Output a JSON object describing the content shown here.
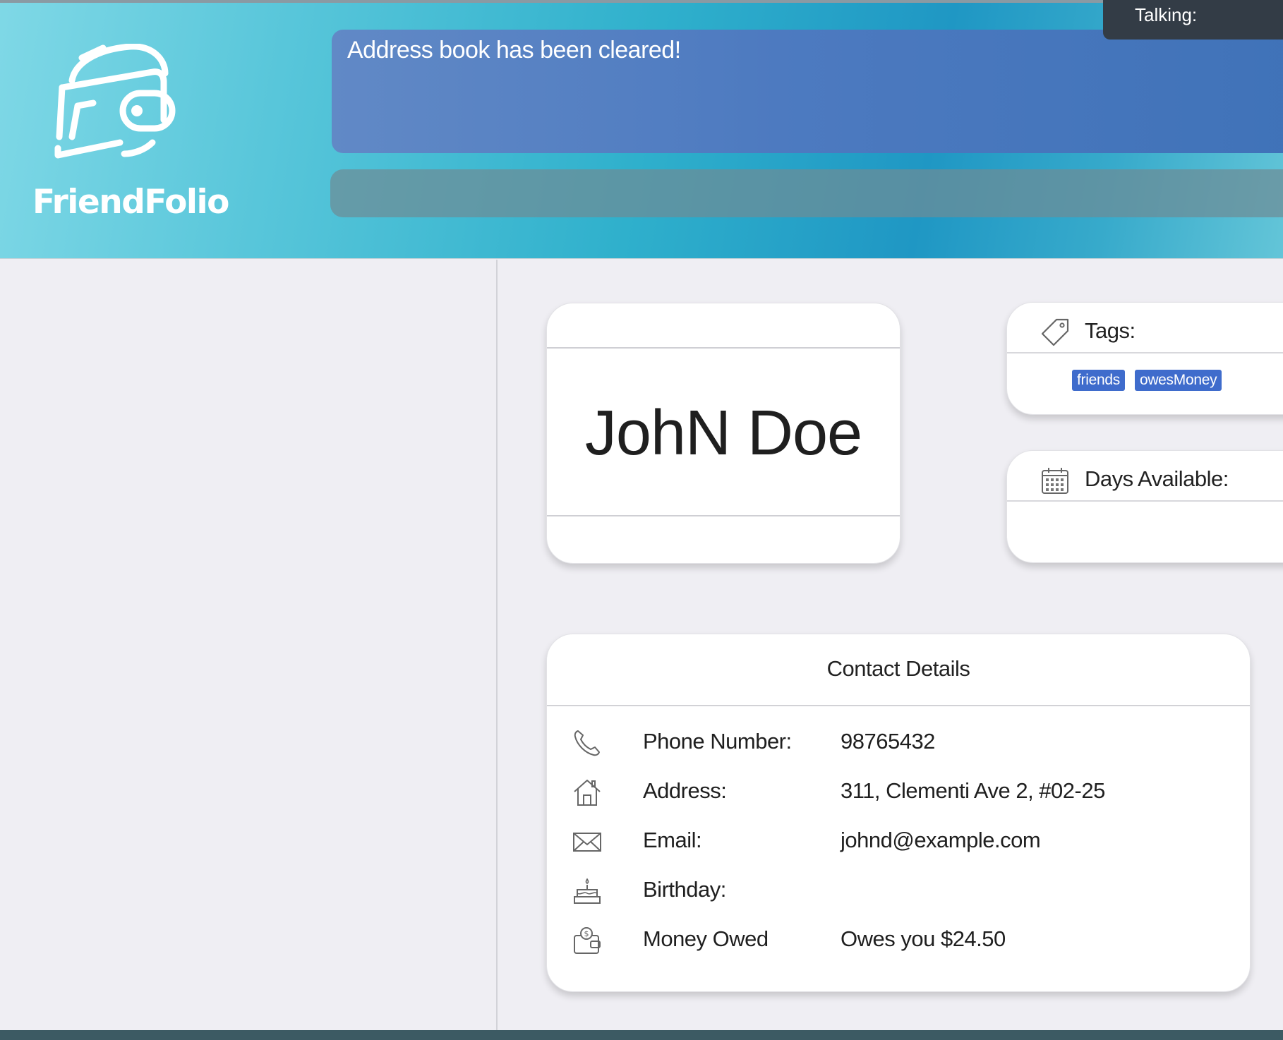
{
  "app": {
    "name": "FriendFolio",
    "talking_label": "Talking:"
  },
  "result_display": {
    "message": "Address book has been cleared!"
  },
  "command_box": {
    "value": ""
  },
  "person": {
    "name": "JohN Doe",
    "tags_title": "Tags:",
    "tags": [
      "friends",
      "owesMoney"
    ],
    "days_title": "Days Available:",
    "days": []
  },
  "contact_details": {
    "title": "Contact Details",
    "rows": [
      {
        "icon": "phone-icon",
        "label": "Phone Number:",
        "value": "98765432"
      },
      {
        "icon": "home-icon",
        "label": "Address:",
        "value": "311, Clementi Ave 2, #02-25"
      },
      {
        "icon": "mail-icon",
        "label": "Email:",
        "value": "johnd@example.com"
      },
      {
        "icon": "cake-icon",
        "label": "Birthday:",
        "value": ""
      },
      {
        "icon": "wallet-money-icon",
        "label": "Money Owed",
        "value": "Owes you $24.50"
      }
    ]
  },
  "colors": {
    "header_gradient_start": "#7fd8e6",
    "header_gradient_mid": "#1f97c4",
    "result_box": "#4d7ac0",
    "tag_bg": "#3f6ccc",
    "talking_bg": "#333c46"
  }
}
